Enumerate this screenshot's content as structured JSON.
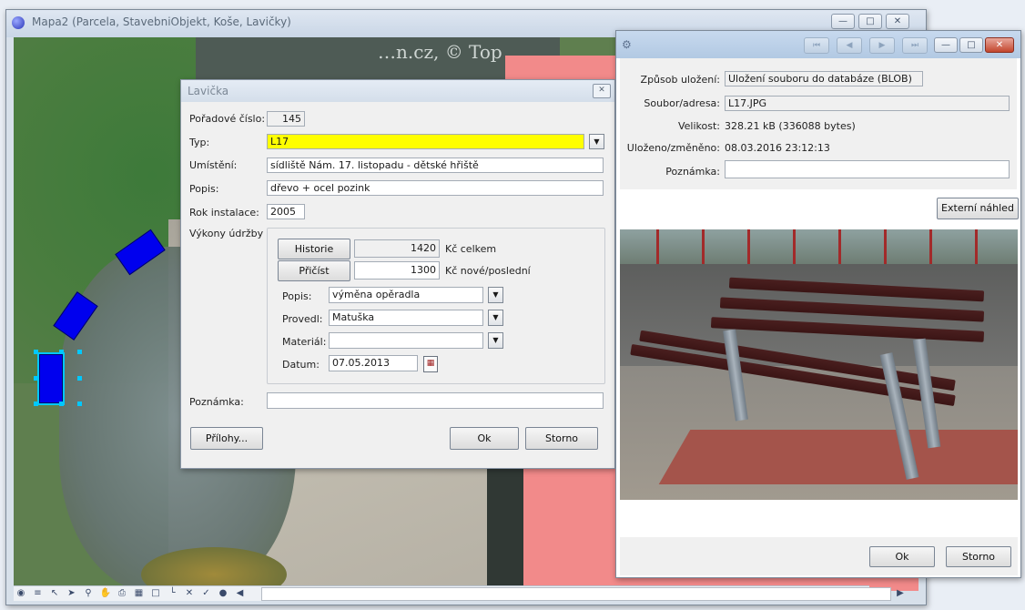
{
  "map_window": {
    "title": "Mapa2 (Parcela, StavebniObjekt, Koše, Lavičky)",
    "map_overlay_text": "…n.cz, © Top"
  },
  "dialog": {
    "title": "Lavička",
    "poradove_cislo_label": "Pořadové číslo:",
    "poradove_cislo_value": "145",
    "typ_label": "Typ:",
    "typ_value": "L17",
    "umisteni_label": "Umístění:",
    "umisteni_value": "sídliště Nám. 17. listopadu - dětské hřiště",
    "popis_label": "Popis:",
    "popis_value": "dřevo + ocel pozink",
    "rok_label": "Rok instalace:",
    "rok_value": "2005",
    "vykony_label": "Výkony údržby",
    "historie_button": "Historie",
    "historie_value": "1420",
    "historie_unit": "Kč celkem",
    "pricist_button": "Přičíst",
    "pricist_value": "1300",
    "pricist_unit": "Kč nové/poslední",
    "m_popis_label": "Popis:",
    "m_popis_value": "výměna opěradla",
    "provedl_label": "Provedl:",
    "provedl_value": "Matuška",
    "material_label": "Materiál:",
    "material_value": "",
    "datum_label": "Datum:",
    "datum_value": "07.05.2013",
    "poznamka_label": "Poznámka:",
    "poznamka_value": "",
    "prilohy_button": "Přílohy...",
    "ok_button": "Ok",
    "storno_button": "Storno"
  },
  "attachment": {
    "zpusob_label": "Způsob uložení:",
    "zpusob_value": "Uložení souboru do databáze (BLOB)",
    "soubor_label": "Soubor/adresa:",
    "soubor_value": "L17.JPG",
    "velikost_label": "Velikost:",
    "velikost_value": "328.21 kB (336088 bytes)",
    "ulozeno_label": "Uloženo/změněno:",
    "ulozeno_value": "08.03.2016 23:12:13",
    "poznamka_label": "Poznámka:",
    "poznamka_value": "",
    "externi_button": "Externí náhled",
    "ok_button": "Ok",
    "storno_button": "Storno"
  }
}
